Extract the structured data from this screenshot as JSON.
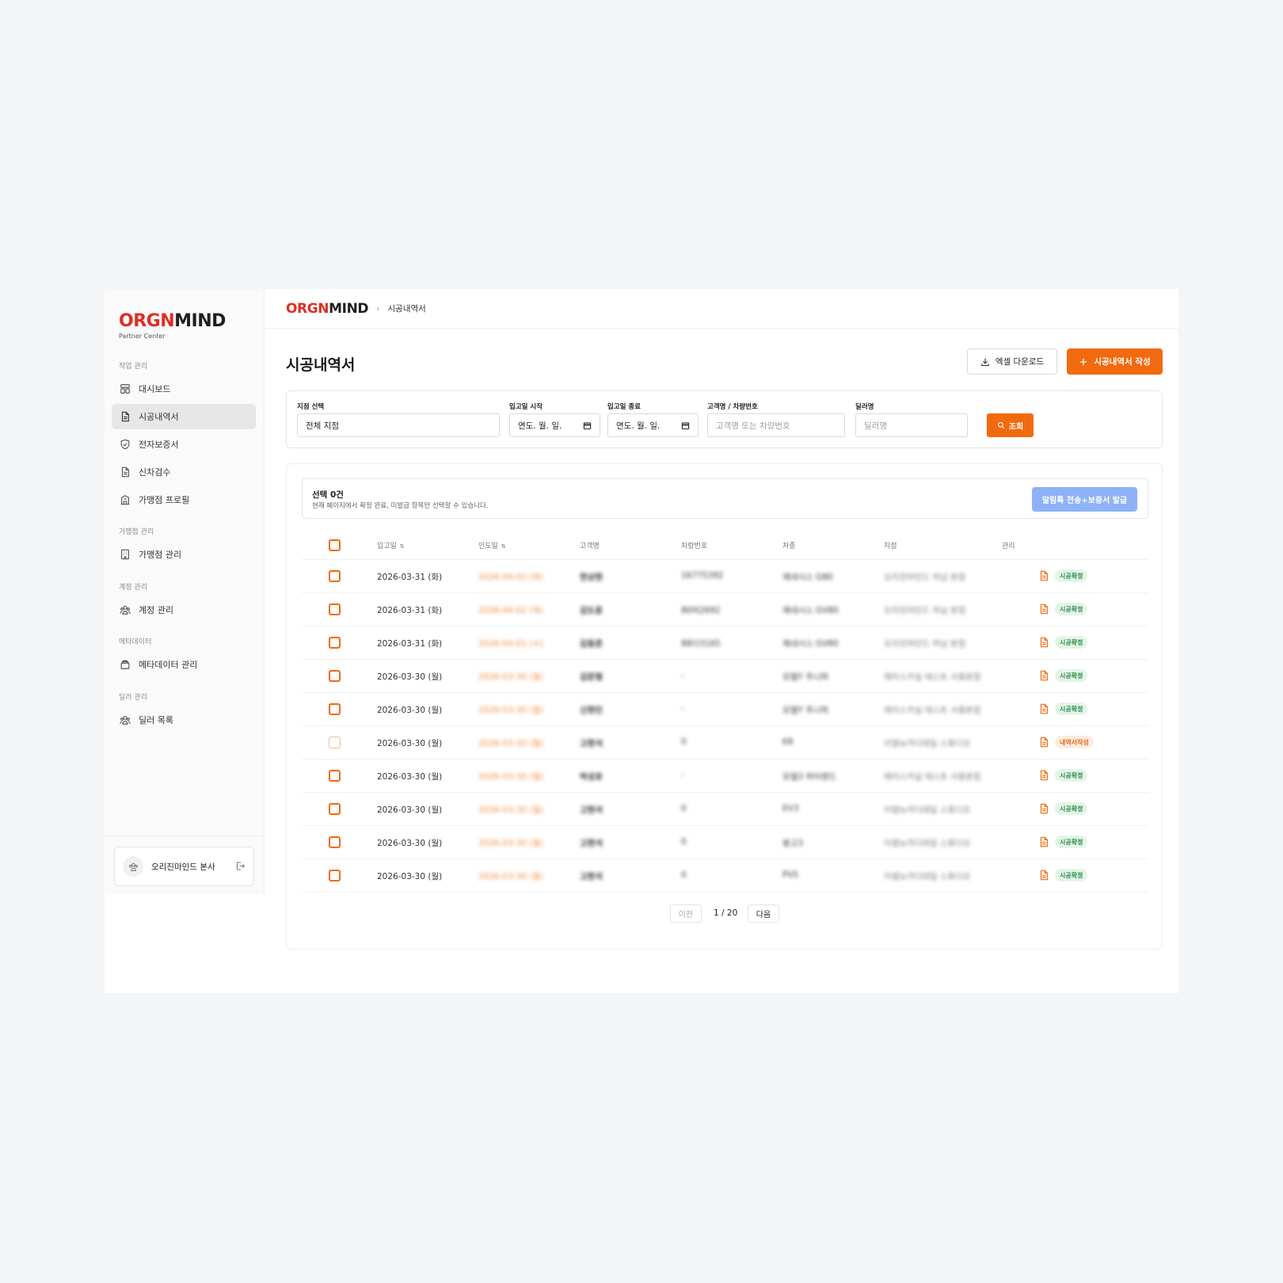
{
  "sidebar": {
    "logo_a": "ORGN",
    "logo_b": "MIND",
    "logo_sub": "Partner Center",
    "sections": [
      {
        "title": "작업 관리"
      },
      {
        "title": "가맹점 관리"
      },
      {
        "title": "계정 관리"
      },
      {
        "title": "메타데이터"
      },
      {
        "title": "딜러 관리"
      }
    ],
    "items": [
      {
        "label": "대시보드",
        "icon": "dashboard-icon"
      },
      {
        "label": "시공내역서",
        "icon": "document-icon",
        "active": true
      },
      {
        "label": "전자보증서",
        "icon": "shield-icon"
      },
      {
        "label": "신차검수",
        "icon": "document-icon"
      },
      {
        "label": "가맹점 프로필",
        "icon": "store-icon"
      },
      {
        "label": "가맹점 관리",
        "icon": "building-icon"
      },
      {
        "label": "계정 관리",
        "icon": "users-icon"
      },
      {
        "label": "메타데이터 관리",
        "icon": "database-icon"
      },
      {
        "label": "딜러 목록",
        "icon": "users-icon"
      }
    ],
    "user": {
      "name": "오리진마인드 본사"
    }
  },
  "topbar": {
    "logo_a": "ORGN",
    "logo_b": "MIND",
    "breadcrumb": "시공내역서"
  },
  "page": {
    "title": "시공내역서",
    "excel_button": "엑셀 다운로드",
    "create_button": "시공내역서 작성"
  },
  "filters": {
    "branch_label": "지점 선택",
    "branch_value": "전체 지점",
    "start_label": "입고일 시작",
    "start_value": "연도. 월. 일.",
    "end_label": "입고일 종료",
    "end_value": "연도. 월. 일.",
    "customer_label": "고객명 / 차량번호",
    "customer_placeholder": "고객명 또는 차량번호",
    "dealer_label": "딜러명",
    "dealer_placeholder": "딜러명",
    "search_button": "조회"
  },
  "selection": {
    "title": "선택 0건",
    "desc": "현재 페이지에서 확정 완료, 미발급 항목만 선택할 수 있습니다.",
    "action_button": "알림톡 전송+보증서 발급"
  },
  "table": {
    "headers": {
      "date_in": "입고일",
      "date_out": "인도일",
      "customer": "고객명",
      "car_no": "차량번호",
      "car_model": "차종",
      "branch": "지점",
      "manage": "관리"
    },
    "rows": [
      {
        "date_in": "2026-03-31 (화)",
        "date_out": "2026-04-02 (목)",
        "customer": "한상현",
        "car_no": "16775392",
        "model": "제네시스 G80",
        "branch": "오리진마인드 하남 본점",
        "status": "시공확정"
      },
      {
        "date_in": "2026-03-31 (화)",
        "date_out": "2026-04-02 (목)",
        "customer": "김도윤",
        "car_no": "80머2692",
        "model": "제네시스 GV80",
        "branch": "오리진마인드 하남 본점",
        "status": "시공확정"
      },
      {
        "date_in": "2026-03-31 (화)",
        "date_out": "2026-04-01 (수)",
        "customer": "김동준",
        "car_no": "88다3165",
        "model": "제네시스 GV80",
        "branch": "오리진마인드 하남 본점",
        "status": "시공확정"
      },
      {
        "date_in": "2026-03-30 (월)",
        "date_out": "2026-03-30 (월)",
        "customer": "김문형",
        "car_no": "-",
        "model": "모델Y 주니퍼",
        "branch": "에이스카실 테스트 사용본점",
        "status": "시공확정"
      },
      {
        "date_in": "2026-03-30 (월)",
        "date_out": "2026-03-30 (월)",
        "customer": "신현민",
        "car_no": "-",
        "model": "모델Y 주니퍼",
        "branch": "에이스카실 테스트 사용본점",
        "status": "시공확정"
      },
      {
        "date_in": "2026-03-30 (월)",
        "date_out": "2026-03-30 (월)",
        "customer": "고현석",
        "car_no": "0",
        "model": "K8",
        "branch": "이엠뉴카디테일 스튜디오",
        "status": "내역서작성"
      },
      {
        "date_in": "2026-03-30 (월)",
        "date_out": "2026-03-30 (월)",
        "customer": "박성호",
        "car_no": "-",
        "model": "모델3 하이랜드",
        "branch": "에이스카실 테스트 사용본점",
        "status": "시공확정"
      },
      {
        "date_in": "2026-03-30 (월)",
        "date_out": "2026-03-30 (월)",
        "customer": "고현석",
        "car_no": "0",
        "model": "EV3",
        "branch": "이엠뉴카디테일 스튜디오",
        "status": "시공확정"
      },
      {
        "date_in": "2026-03-30 (월)",
        "date_out": "2026-03-30 (월)",
        "customer": "고현석",
        "car_no": "0",
        "model": "봉고3",
        "branch": "이엠뉴카디테일 스튜디오",
        "status": "시공확정"
      },
      {
        "date_in": "2026-03-30 (월)",
        "date_out": "2026-03-30 (월)",
        "customer": "고현석",
        "car_no": "0",
        "model": "PV5",
        "branch": "이엠뉴카디테일 스튜디오",
        "status": "시공확정"
      }
    ]
  },
  "pagination": {
    "prev": "이전",
    "info": "1 / 20",
    "next": "다음"
  },
  "colors": {
    "accent": "#f26a0f",
    "brand_red": "#e02d24",
    "action_blue": "#8eb2f7"
  }
}
